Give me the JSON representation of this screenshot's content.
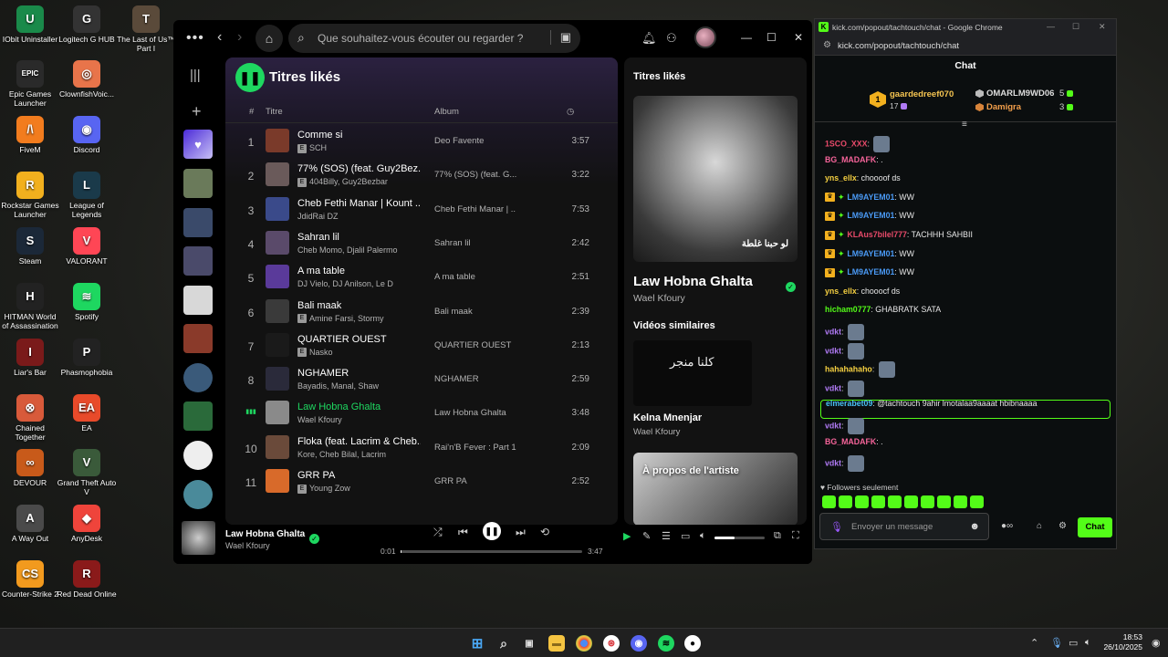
{
  "desktop": {
    "icons": [
      {
        "label": "IObit Uninstaller",
        "icon": "iobit-icon",
        "color": "#1a8a4a",
        "glyph": "U"
      },
      {
        "label": "Logitech G HUB",
        "icon": "logitech-icon",
        "color": "#333",
        "glyph": "G"
      },
      {
        "label": "The Last of Us™ Part I",
        "icon": "tlou-icon",
        "color": "#5a4a3a",
        "glyph": "T"
      },
      {
        "label": "Epic Games Launcher",
        "icon": "epic-icon",
        "color": "#2a2a2a",
        "glyph": "EPIC"
      },
      {
        "label": "ClownfishVoic...",
        "icon": "clownfish-icon",
        "color": "#e8744a",
        "glyph": "◎"
      },
      {
        "label": "FiveM",
        "icon": "fivem-icon",
        "color": "#f27c1e",
        "glyph": "/\\"
      },
      {
        "label": "Discord",
        "icon": "discord-icon",
        "color": "#5865f2",
        "glyph": "◉"
      },
      {
        "label": "Rockstar Games Launcher",
        "icon": "rockstar-icon",
        "color": "#f2b01e",
        "glyph": "R"
      },
      {
        "label": "League of Legends",
        "icon": "lol-icon",
        "color": "#1a3a4a",
        "glyph": "L"
      },
      {
        "label": "Steam",
        "icon": "steam-icon",
        "color": "#1b2838",
        "glyph": "S"
      },
      {
        "label": "VALORANT",
        "icon": "valorant-icon",
        "color": "#ff4655",
        "glyph": "V"
      },
      {
        "label": "HITMAN World of Assassination",
        "icon": "hitman-icon",
        "color": "#222",
        "glyph": "H"
      },
      {
        "label": "Spotify",
        "icon": "spotify-icon",
        "color": "#1ed760",
        "glyph": "≋"
      },
      {
        "label": "Liar's Bar",
        "icon": "liarsbar-icon",
        "color": "#7a1a1a",
        "glyph": "I"
      },
      {
        "label": "Phasmophobia",
        "icon": "phasmophobia-icon",
        "color": "#222",
        "glyph": "P"
      },
      {
        "label": "Chained Together",
        "icon": "chained-icon",
        "color": "#d85a3a",
        "glyph": "⊗"
      },
      {
        "label": "EA",
        "icon": "ea-icon",
        "color": "#e84a2a",
        "glyph": "EA"
      },
      {
        "label": "DEVOUR",
        "icon": "devour-icon",
        "color": "#c85a1a",
        "glyph": "∞"
      },
      {
        "label": "Grand Theft Auto V",
        "icon": "gta-icon",
        "color": "#3a5a3a",
        "glyph": "V"
      },
      {
        "label": "A Way Out",
        "icon": "awayout-icon",
        "color": "#4a4a4a",
        "glyph": "A"
      },
      {
        "label": "AnyDesk",
        "icon": "anydesk-icon",
        "color": "#ef443b",
        "glyph": "◆"
      },
      {
        "label": "Counter-Strike 2",
        "icon": "cs2-icon",
        "color": "#f29a1e",
        "glyph": "CS"
      },
      {
        "label": "Red Dead Online",
        "icon": "rdo-icon",
        "color": "#8a1a1a",
        "glyph": "R"
      }
    ]
  },
  "spotify": {
    "search_placeholder": "Que souhaitez-vous écouter ou regarder ?",
    "playlist_title": "Titres likés",
    "columns": {
      "num": "#",
      "title": "Titre",
      "album": "Album"
    },
    "tracks": [
      {
        "num": "1",
        "title": "Comme si",
        "artist": "SCH",
        "album": "Deo Favente",
        "duration": "3:57",
        "explicit": "E",
        "art_color": "#7a3a2a"
      },
      {
        "num": "2",
        "title": "77% (SOS) (feat. Guy2Bez...",
        "artist": "404Billy, Guy2Bezbar",
        "album": "77% (SOS) (feat. G...",
        "duration": "3:22",
        "explicit": "E",
        "art_color": "#6a5a5a"
      },
      {
        "num": "3",
        "title": "Cheb Fethi Manar | Kount ...",
        "artist": "JdidRai DZ",
        "album": "Cheb Fethi Manar | ...",
        "duration": "7:53",
        "explicit": "",
        "art_color": "#3a4a8a"
      },
      {
        "num": "4",
        "title": "Sahran lil",
        "artist": "Cheb Momo, Djalil Palermo",
        "album": "Sahran lil",
        "duration": "2:42",
        "explicit": "",
        "art_color": "#5a4a6a"
      },
      {
        "num": "5",
        "title": "A ma table",
        "artist": "DJ Vielo, DJ Anilson, Le D",
        "album": "A ma table",
        "duration": "2:51",
        "explicit": "",
        "art_color": "#5a3a9a"
      },
      {
        "num": "6",
        "title": "Bali maak",
        "artist": "Amine Farsi, Stormy",
        "album": "Bali maak",
        "duration": "2:39",
        "explicit": "E",
        "art_color": "#3a3a3a"
      },
      {
        "num": "7",
        "title": "QUARTIER OUEST",
        "artist": "Nasko",
        "album": "QUARTIER OUEST",
        "duration": "2:13",
        "explicit": "E",
        "art_color": "#1a1a1a"
      },
      {
        "num": "8",
        "title": "NGHAMER",
        "artist": "Bayadis, Manal, Shaw",
        "album": "NGHAMER",
        "duration": "2:59",
        "explicit": "",
        "art_color": "#2a2a3a"
      },
      {
        "num": "",
        "title": "Law Hobna Ghalta",
        "artist": "Wael Kfoury",
        "album": "Law Hobna Ghalta",
        "duration": "3:48",
        "explicit": "",
        "art_color": "#8a8a8a",
        "playing": true
      },
      {
        "num": "10",
        "title": "Floka (feat. Lacrim & Cheb...",
        "artist": "Kore, Cheb Bilal, Lacrim",
        "album": "Rai'n'B Fever : Part 1",
        "duration": "2:09",
        "explicit": "",
        "art_color": "#6a4a3a"
      },
      {
        "num": "11",
        "title": "GRR PA",
        "artist": "Young Zow",
        "album": "GRR PA",
        "duration": "2:52",
        "explicit": "E",
        "art_color": "#d86a2a"
      }
    ],
    "right_panel": {
      "header": "Titres likés",
      "song": "Law Hobna Ghalta",
      "artist": "Wael Kfoury",
      "cover_text": "لو حبنا غلطة",
      "similar_header": "Vidéos similaires",
      "video_title": "Kelna Mnenjar",
      "video_artist": "Wael Kfoury",
      "video_cover_text": "كلنا منجر",
      "about_header": "À propos de l'artiste"
    },
    "player": {
      "title": "Law Hobna Ghalta",
      "artist": "Wael Kfoury",
      "elapsed": "0:01",
      "total": "3:47",
      "progress": 0.005,
      "volume": 0.4
    }
  },
  "chat_window": {
    "window_title": "kick.com/popout/tachtouch/chat - Google Chrome",
    "url": "kick.com/popout/tachtouch/chat",
    "header": "Chat",
    "leaderboard": {
      "rank": "1",
      "first_name": "gaardedreef070",
      "first_score": "17",
      "second_name": "OMARLM9WD06",
      "second_score": "5",
      "third_name": "Damigra",
      "third_score": "3"
    },
    "messages": [
      {
        "user": "1SCO_XXX",
        "color": "#e84a6a",
        "text": "",
        "emote": true,
        "badges": false
      },
      {
        "user": "BG_MADAFK",
        "color": "#f5649a",
        "text": ".",
        "emote": false,
        "badges": false
      },
      {
        "user": "yns_ellx",
        "color": "#f5d041",
        "text": "choooof ds",
        "emote": false,
        "badges": false
      },
      {
        "user": "LM9AYEM01",
        "color": "#4a9af5",
        "text": "WW",
        "emote": false,
        "badges": true
      },
      {
        "user": "LM9AYEM01",
        "color": "#4a9af5",
        "text": "WW",
        "emote": false,
        "badges": true
      },
      {
        "user": "KLAus7bilel777",
        "color": "#e84a6a",
        "text": "TACHHH SAHBII",
        "emote": false,
        "badges": true
      },
      {
        "user": "LM9AYEM01",
        "color": "#4a9af5",
        "text": "WW",
        "emote": false,
        "badges": true
      },
      {
        "user": "LM9AYEM01",
        "color": "#4a9af5",
        "text": "WW",
        "emote": false,
        "badges": true
      },
      {
        "user": "yns_ellx",
        "color": "#f5d041",
        "text": "chooocf ds",
        "emote": false,
        "badges": false
      },
      {
        "user": "hicham0777",
        "color": "#53fc18",
        "text": "GHABRATK SATA",
        "emote": false,
        "badges": false
      },
      {
        "user": "vdkt",
        "color": "#b07af5",
        "text": "",
        "emote": true,
        "badges": false
      },
      {
        "user": "vdkt",
        "color": "#b07af5",
        "text": "",
        "emote": true,
        "badges": false
      },
      {
        "user": "hahahahaho",
        "color": "#f5d041",
        "text": "",
        "emote": true,
        "badges": false
      },
      {
        "user": "vdkt",
        "color": "#b07af5",
        "text": "",
        "emote": true,
        "badges": false
      },
      {
        "user": "elmerabet09",
        "color": "#4ac0f5",
        "text": "@tachtouch 9ahir lmotalaa9aaaat hbibnaaaa",
        "emote": false,
        "badges": false
      },
      {
        "user": "vdkt",
        "color": "#b07af5",
        "text": "",
        "emote": true,
        "badges": false
      },
      {
        "user": "BG_MADAFK",
        "color": "#f5649a",
        "text": ".",
        "emote": false,
        "badges": false
      },
      {
        "user": "vdkt",
        "color": "#b07af5",
        "text": "",
        "emote": true,
        "badges": false
      }
    ],
    "followers_label": "Followers seulement",
    "input_placeholder": "Envoyer un message",
    "send_label": "Chat"
  },
  "taskbar": {
    "time": "18:53",
    "date": "26/10/2025"
  },
  "colors": {
    "spotify_green": "#1ed760",
    "kick_green": "#53fc18"
  }
}
